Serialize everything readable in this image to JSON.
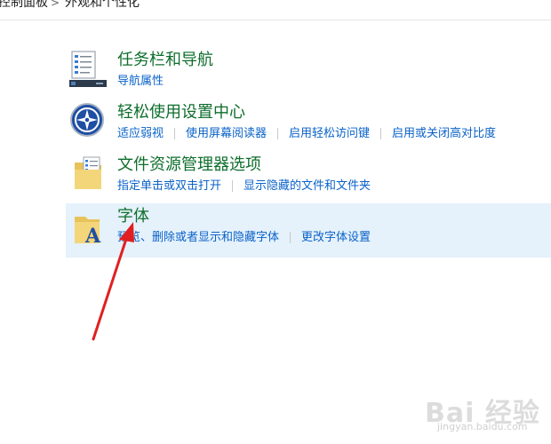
{
  "breadcrumb": {
    "items": [
      "控制面板",
      "外观和个性化"
    ],
    "separator": ">"
  },
  "categories": [
    {
      "title": "任务栏和导航",
      "icon": "taskbar-checklist-icon",
      "links": [
        "导航属性"
      ]
    },
    {
      "title": "轻松使用设置中心",
      "icon": "ease-of-access-icon",
      "links": [
        "适应弱视",
        "使用屏幕阅读器",
        "启用轻松访问键",
        "启用或关闭高对比度"
      ]
    },
    {
      "title": "文件资源管理器选项",
      "icon": "folder-checklist-icon",
      "links": [
        "指定单击或双击打开",
        "显示隐藏的文件和文件夹"
      ]
    },
    {
      "title": "字体",
      "icon": "font-folder-icon",
      "links": [
        "预览、删除或者显示和隐藏字体",
        "更改字体设置"
      ],
      "selected": true
    }
  ],
  "annotation": {
    "type": "red-arrow",
    "color": "#e02020"
  },
  "watermark": {
    "main": "Bai 经验",
    "sub": "jingyan.baidu.com"
  },
  "colors": {
    "title": "#0e6e2c",
    "link": "#0a62c9",
    "selected_bg": "#e5f1fb"
  }
}
